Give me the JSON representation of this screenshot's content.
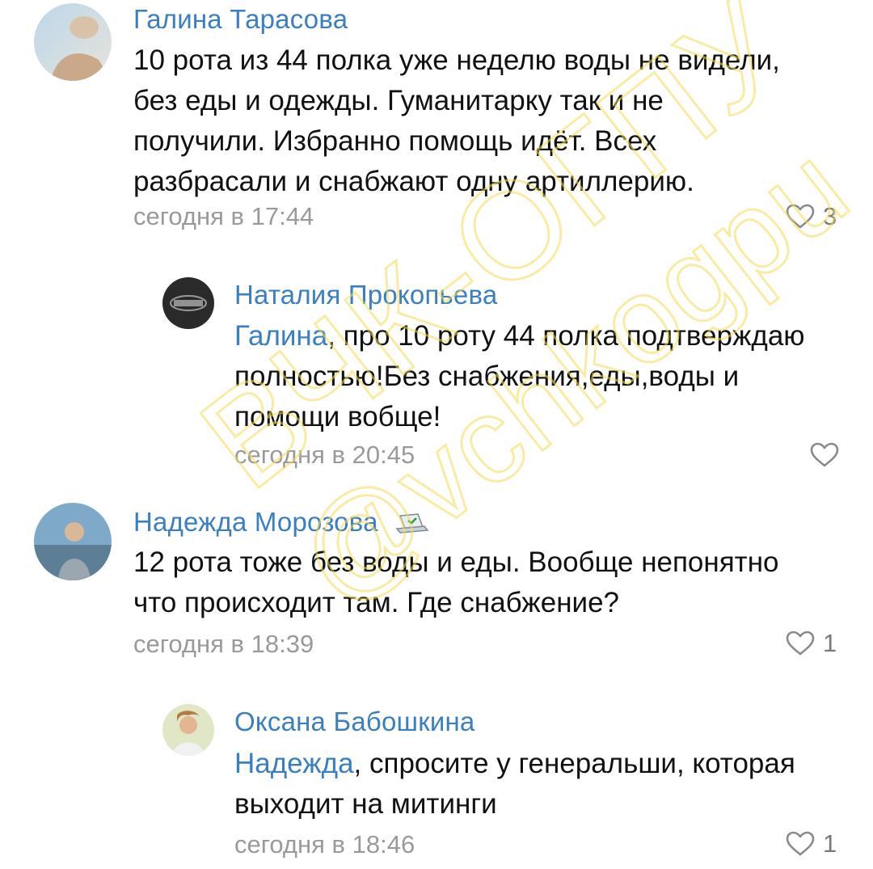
{
  "comments": [
    {
      "author": "Галина Тарасова",
      "lines": [
        "10 рота из 44 полка уже неделю воды не видели,",
        "без еды и одежды. Гуманитарку так и не",
        "получили. Избранно помощь идёт. Всех",
        "разбрасали и снабжают одну артиллерию."
      ],
      "timestamp": "сегодня в 17:44",
      "likes": "3"
    },
    {
      "author": "Наталия Прокопьева",
      "mention": "Галина",
      "lines": [
        ", про 10 роту 44 полка подтверждаю",
        "полностью!Без снабжения,еды,воды и",
        "помощи вобще!"
      ],
      "timestamp": "сегодня в 20:45",
      "likes": ""
    },
    {
      "author": "Надежда Морозова",
      "lines": [
        "12 рота тоже без воды и еды. Вообще непонятно",
        "что происходит там. Где снабжение?"
      ],
      "timestamp": "сегодня в 18:39",
      "likes": "1"
    },
    {
      "author": "Оксана Бабошкина",
      "mention": "Надежда",
      "lines": [
        ", спросите у генеральши, которая",
        "выходит на митинги"
      ],
      "timestamp": "сегодня в 18:46",
      "likes": "1"
    }
  ],
  "watermark": {
    "line1": "ВЧК-ОГПУ",
    "line2": "@vchkogpu"
  },
  "colors": {
    "link": "#3a7fc1",
    "text": "#111111",
    "muted": "#9a9a9a",
    "watermark": "#f7e98a"
  }
}
